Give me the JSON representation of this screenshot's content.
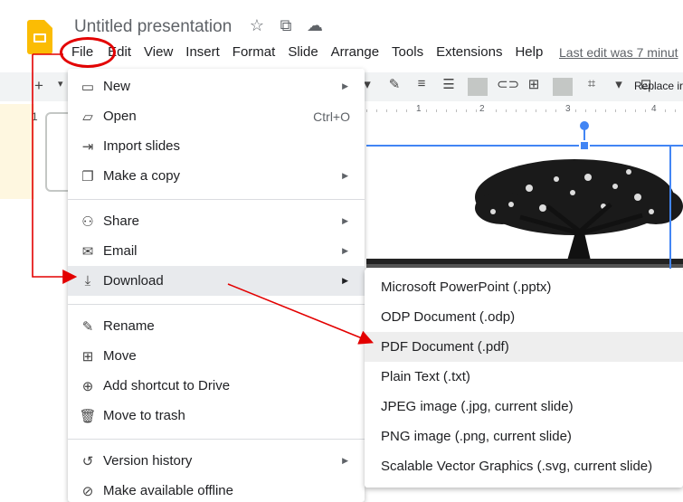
{
  "header": {
    "title": "Untitled presentation",
    "star_icon": "☆",
    "move_icon": "⧉",
    "cloud_icon": "☁",
    "last_edit": "Last edit was 7 minut"
  },
  "menubar": {
    "items": [
      "File",
      "Edit",
      "View",
      "Insert",
      "Format",
      "Slide",
      "Arrange",
      "Tools",
      "Extensions",
      "Help"
    ]
  },
  "toolbar": {
    "new_slide_glyph": "+",
    "caret_glyph": "▾",
    "replace_label": "Replace ir"
  },
  "filmstrip": {
    "slide_number": "1"
  },
  "ruler": {
    "marks": [
      "1",
      "2",
      "3",
      "4"
    ]
  },
  "file_menu": {
    "items": [
      {
        "label": "New",
        "submenu": true
      },
      {
        "label": "Open",
        "shortcut": "Ctrl+O"
      },
      {
        "label": "Import slides"
      },
      {
        "label": "Make a copy",
        "submenu": true
      },
      {
        "label": "Share",
        "submenu": true
      },
      {
        "label": "Email",
        "submenu": true
      },
      {
        "label": "Download",
        "submenu": true,
        "highlighted": true
      },
      {
        "label": "Rename"
      },
      {
        "label": "Move"
      },
      {
        "label": "Add shortcut to Drive"
      },
      {
        "label": "Move to trash"
      },
      {
        "label": "Version history",
        "submenu": true
      },
      {
        "label": "Make available offline"
      }
    ]
  },
  "download_menu": {
    "items": [
      "Microsoft PowerPoint (.pptx)",
      "ODP Document (.odp)",
      "PDF Document (.pdf)",
      "Plain Text (.txt)",
      "JPEG image (.jpg, current slide)",
      "PNG image (.png, current slide)",
      "Scalable Vector Graphics (.svg, current slide)"
    ],
    "highlighted_index": 2
  },
  "colors": {
    "annotation": "#e30000",
    "selection": "#4285f4",
    "logo": "#fbbc04",
    "menu_highlight": "#e8eaed"
  }
}
